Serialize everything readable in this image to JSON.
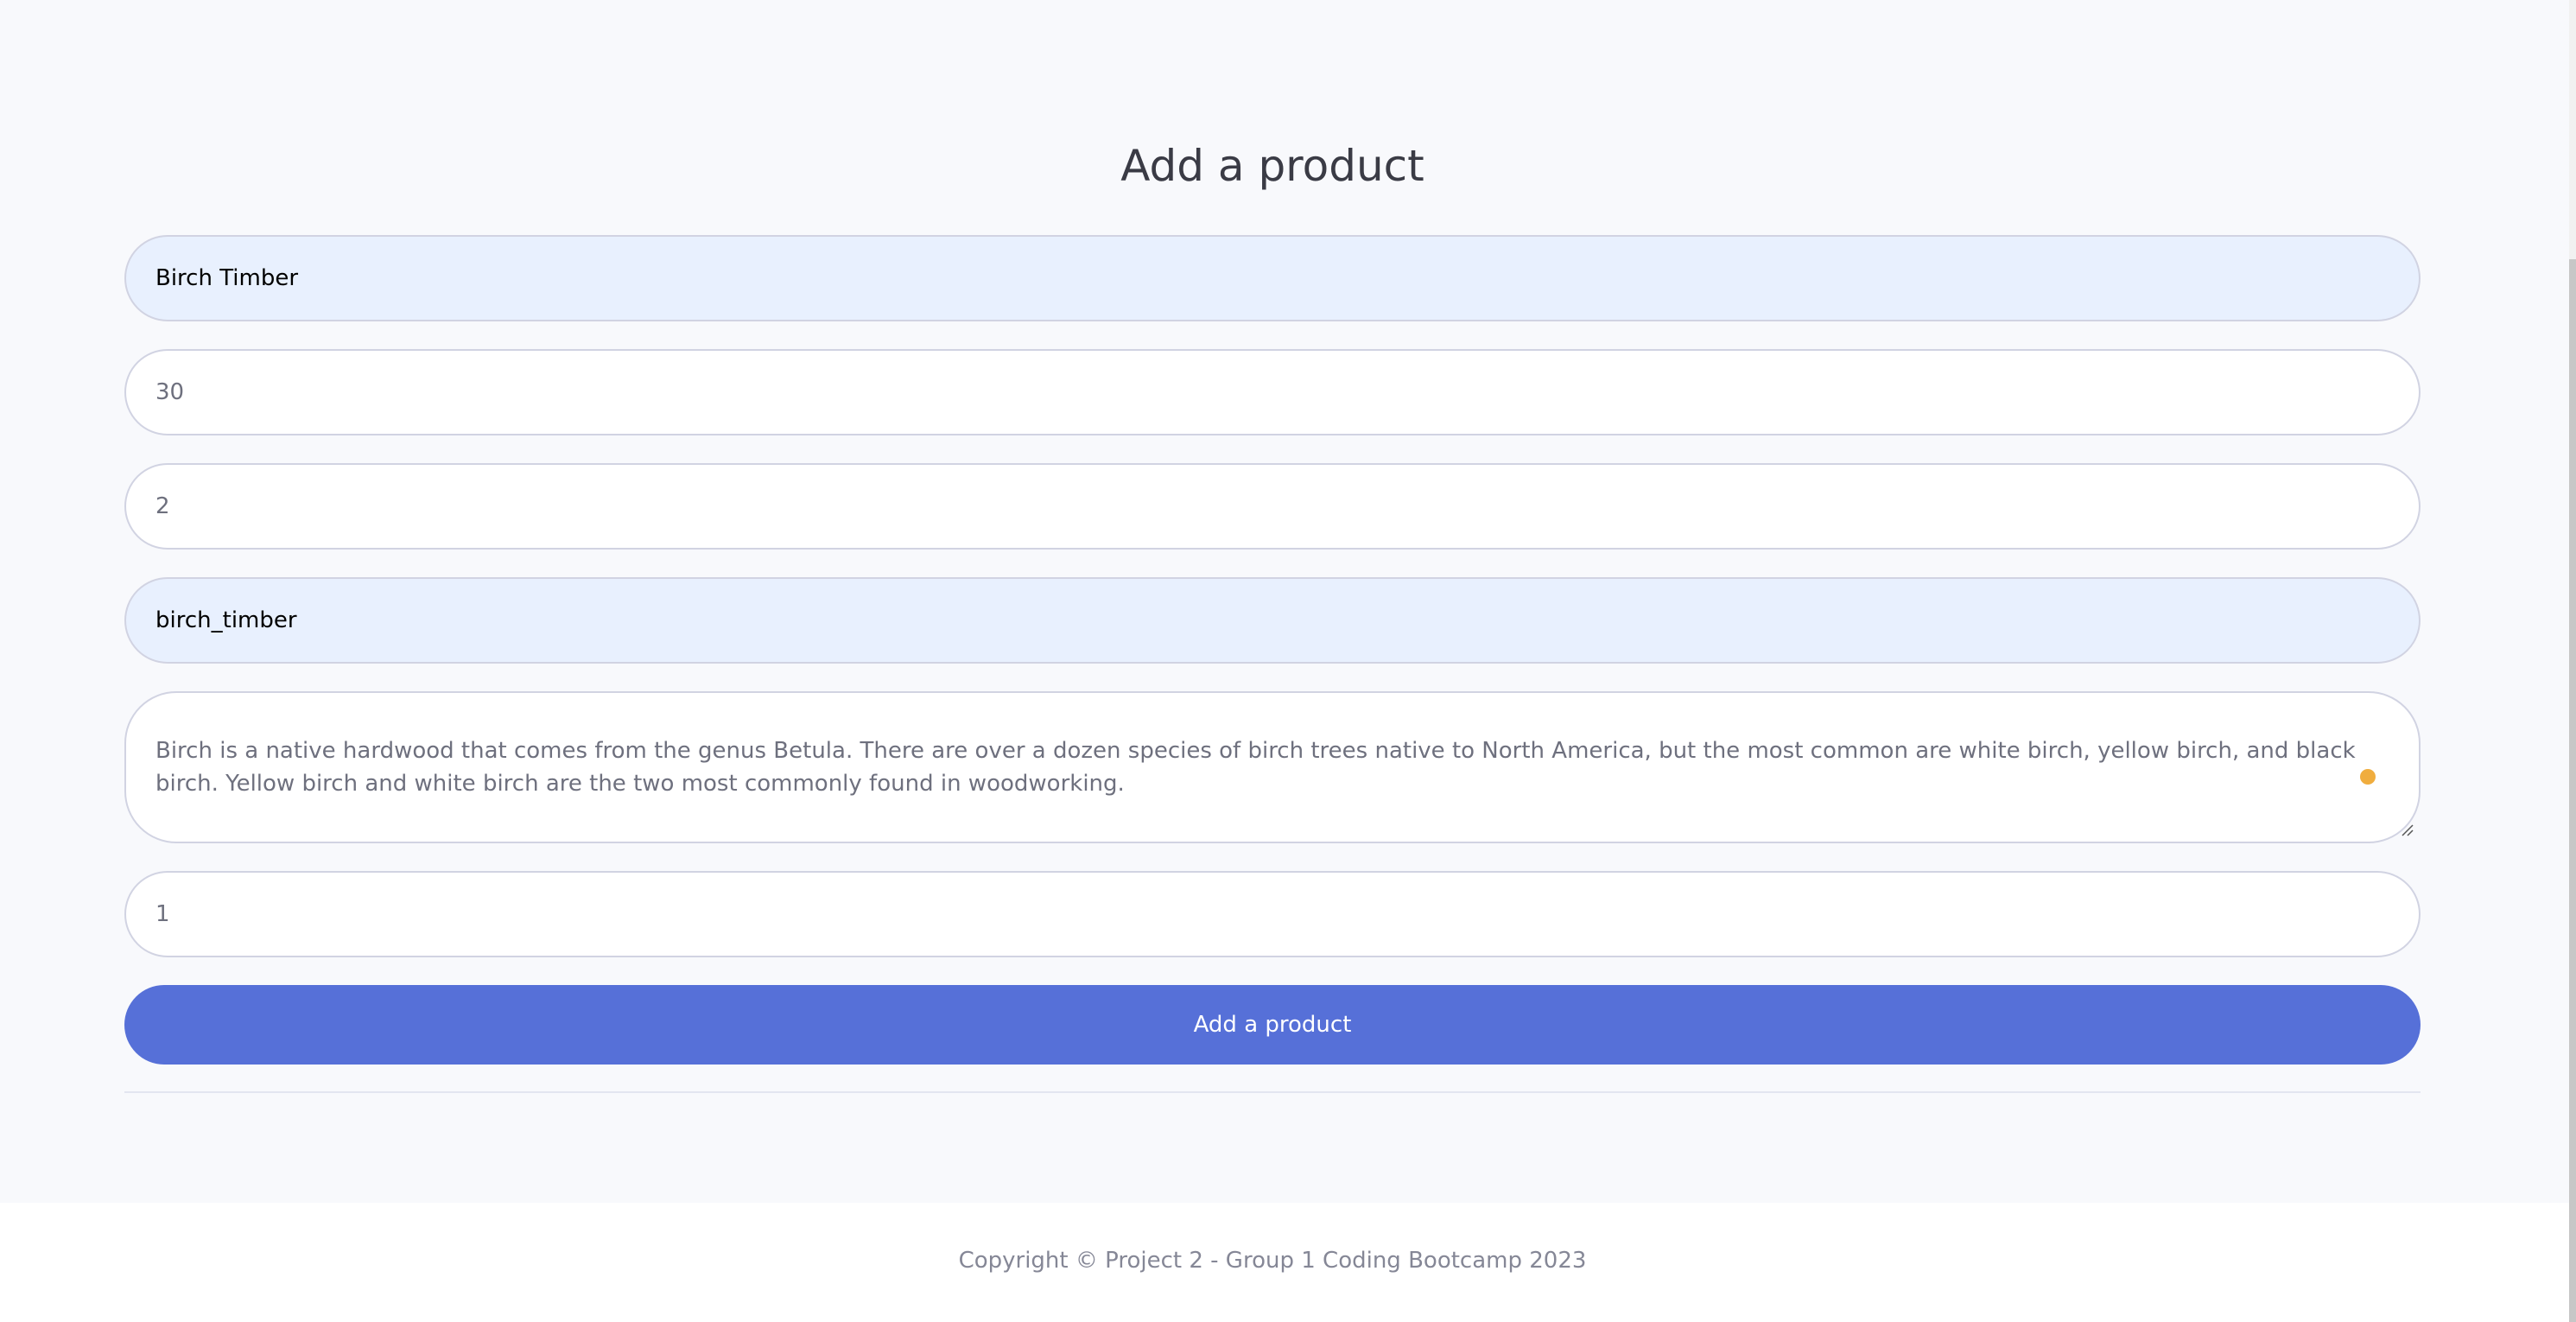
{
  "page": {
    "title": "Add a product"
  },
  "form": {
    "name_value": "Birch Timber",
    "price_value": "30",
    "stock_value": "2",
    "image_value": "birch_timber",
    "description_value": "Birch is a native hardwood that comes from the genus Betula. There are over a dozen species of birch trees native to North America, but the most common are white birch, yellow birch, and black birch. Yellow birch and white birch are the two most commonly found in woodworking.",
    "category_value": "1",
    "submit_label": "Add a product"
  },
  "footer": {
    "copyright": "Copyright © Project 2 - Group 1 Coding Bootcamp 2023"
  },
  "colors": {
    "accent": "#5670d8",
    "autofill_bg": "#e8f0fe",
    "page_bg": "#f8f9fc",
    "border": "#d1d3e2",
    "grammar_dot": "#f0ad3e"
  }
}
